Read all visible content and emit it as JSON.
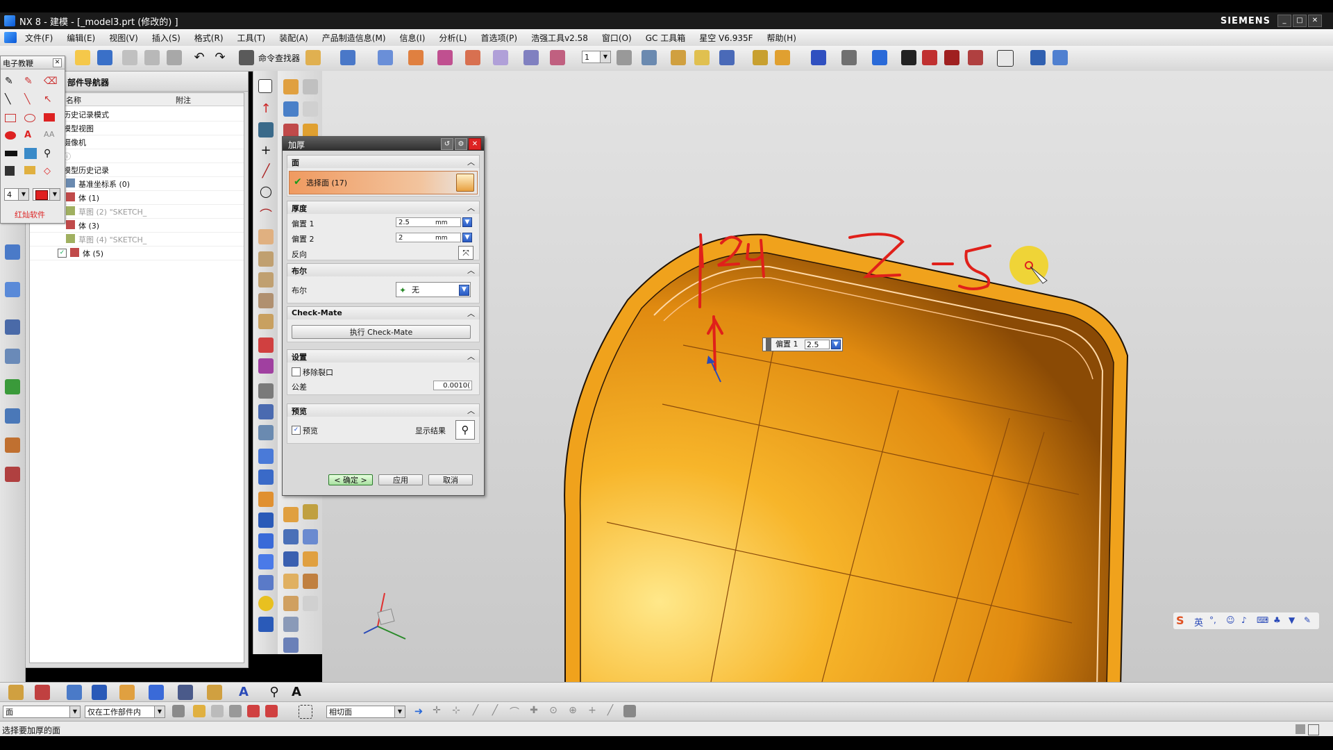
{
  "window": {
    "title": "NX 8 - 建模 - [_model3.prt (修改的) ]",
    "brand": "SIEMENS"
  },
  "menu": [
    "文件(F)",
    "编辑(E)",
    "视图(V)",
    "插入(S)",
    "格式(R)",
    "工具(T)",
    "装配(A)",
    "产品制造信息(M)",
    "信息(I)",
    "分析(L)",
    "首选项(P)",
    "浩强工具v2.58",
    "窗口(O)",
    "GC 工具箱",
    "星空 V6.935F",
    "帮助(H)"
  ],
  "toolbar": {
    "command_finder": "命令查找器",
    "layer_value": "1"
  },
  "palette": {
    "title": "电子教鞭",
    "size_value": "4",
    "footer": "红灿软件",
    "text_icon": "AA"
  },
  "navigator": {
    "title": "部件导航器",
    "columns": [
      "名称",
      "附注"
    ],
    "items": [
      {
        "label": "历史记录模式"
      },
      {
        "label": "模型视图"
      },
      {
        "label": "摄像机"
      },
      {
        "label": "ⓘ"
      },
      {
        "label": "模型历史记录"
      },
      {
        "label": "基准坐标系 (0)"
      },
      {
        "label": "体 (1)"
      },
      {
        "label": "草图 (2) \"SKETCH_"
      },
      {
        "label": "体 (3)"
      },
      {
        "label": "草图 (4) \"SKETCH_"
      },
      {
        "label": "体 (5)"
      }
    ]
  },
  "dialog": {
    "title": "加厚",
    "face_section": "面",
    "select_face": "选择面 (17)",
    "thickness_section": "厚度",
    "offset1_label": "偏置 1",
    "offset1_value": "2.5",
    "offset1_unit": "mm",
    "offset2_label": "偏置 2",
    "offset2_value": "2",
    "offset2_unit": "mm",
    "reverse_label": "反向",
    "boolean_section": "布尔",
    "boolean_label": "布尔",
    "boolean_value": "无",
    "checkmate_section": "Check-Mate",
    "checkmate_button": "执行 Check-Mate",
    "settings_section": "设置",
    "remove_gap_label": "移除裂口",
    "tolerance_label": "公差",
    "tolerance_value": "0.0010(",
    "preview_section": "预览",
    "preview_label": "预览",
    "show_result_label": "显示结果",
    "ok_button": "< 确定 >",
    "apply_button": "应用",
    "cancel_button": "取消"
  },
  "viewport": {
    "offset_callout_label": "偏置 1",
    "offset_callout_value": "2.5",
    "annotation_colors": {
      "ink": "#e0201a",
      "cursor_halo": "#f2d21a"
    },
    "model_color": "#f0a21c",
    "ime_label": "英"
  },
  "bottombar": {
    "filter_value": "面",
    "scope_value": "仅在工作部件内",
    "snap_value": "相切面"
  },
  "status": {
    "text": "选择要加厚的面"
  },
  "colors": {
    "accent": "#2a5bc4",
    "title_bar": "#1b1b1b",
    "select_highlight": "#f0a070"
  }
}
